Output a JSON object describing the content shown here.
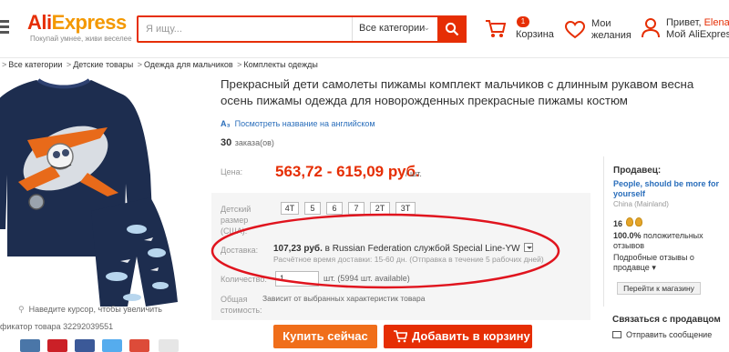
{
  "header": {
    "logo_main": "Ali",
    "logo_tail": "xpress",
    "slogan": "Покупай умнее, живи веселее",
    "search_placeholder": "Я ищу...",
    "category_select": "Все категории",
    "cart_count": "1",
    "cart_label": "Корзина",
    "wishlist_label": "Мои желания",
    "greeting": "Привет,",
    "user_name": "Elena",
    "my_account": "Мой AliExpress"
  },
  "breadcrumb": [
    "Все категории",
    "Детские товары",
    "Одежда для мальчиков",
    "Комплекты одежды"
  ],
  "breadcrumb_sep": ">",
  "gallery": {
    "zoom_hint": "Наведите курсор, чтобы увеличить",
    "product_id": "фикатор товара 32292039551"
  },
  "product": {
    "title": "Прекрасный дети самолеты пижамы комплект мальчиков с длинным рукавом весна осень пижамы одежда для новорожденных прекрасные пижамы костюм",
    "translate_link": "Посмотреть название на английском",
    "orders_count": "30",
    "orders_label": "заказа(ов)",
    "price_label": "Цена:",
    "price": "563,72 - 615,09 руб.",
    "price_unit": "/ шт.",
    "size_label": "Детский размер (США):",
    "sizes": [
      "4T",
      "5",
      "6",
      "7",
      "2T",
      "3T"
    ],
    "shipping_label": "Доставка:",
    "shipping_price": "107,23 руб.",
    "shipping_text": "в Russian Federation службой Special Line-YW",
    "shipping_time": "Расчётное время доставки: 15-60 дн. (Отправка в течение 5 рабочих дней)",
    "quantity_label": "Количество:",
    "quantity_value": "1",
    "quantity_note": "шт. (5994 шт. available)",
    "total_label": "Общая стоимость:",
    "total_note": "Зависит от выбранных характеристик товара",
    "buy_now": "Купить сейчас",
    "add_to_cart": "Добавить в корзину"
  },
  "seller": {
    "heading": "Продавец:",
    "store_name": "People, should be more for yourself",
    "country": "China (Mainland)",
    "score": "16",
    "positive_pct": "100.0%",
    "positive_label": "положительных отзывов",
    "details_link": "Подробные отзывы о продавце",
    "store_button": "Перейти к магазину"
  },
  "contact": {
    "heading": "Связаться с продавцом",
    "message": "Отправить сообщение"
  },
  "colors": {
    "brand_red": "#e62e04",
    "brand_orange": "#f39800",
    "buy_orange": "#f06e1a",
    "link_blue": "#2a6ebb",
    "annotation_red": "#e0141e"
  }
}
